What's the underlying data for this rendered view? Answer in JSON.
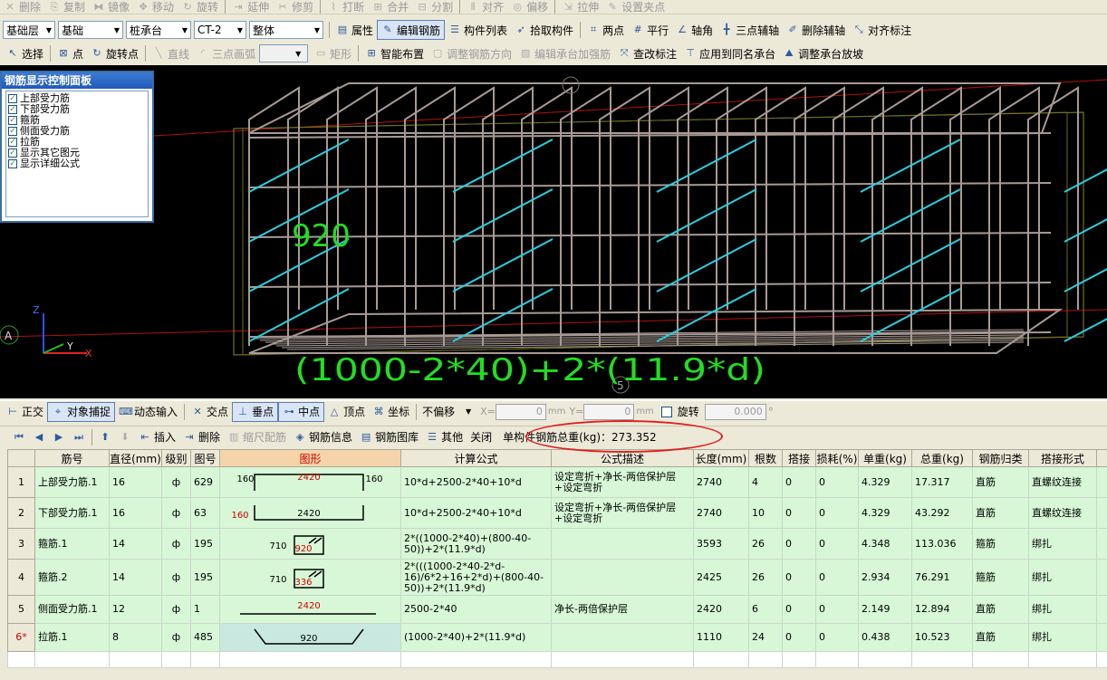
{
  "toolbar1": [
    {
      "label": "删除",
      "icon": "delete-icon",
      "glyph": "✕",
      "disabled": true
    },
    {
      "label": "复制",
      "icon": "copy-icon",
      "glyph": "⎘",
      "disabled": true
    },
    {
      "label": "镜像",
      "icon": "mirror-icon",
      "glyph": "⧓",
      "disabled": true
    },
    {
      "label": "移动",
      "icon": "move-icon",
      "glyph": "✥",
      "disabled": true
    },
    {
      "label": "旋转",
      "icon": "rotate-icon",
      "glyph": "↻",
      "disabled": true
    },
    {
      "label": "延伸",
      "icon": "extend-icon",
      "glyph": "⇥",
      "disabled": true
    },
    {
      "label": "修剪",
      "icon": "trim-icon",
      "glyph": "✂",
      "disabled": true
    },
    {
      "label": "打断",
      "icon": "break-icon",
      "glyph": "⌇",
      "disabled": true
    },
    {
      "label": "合并",
      "icon": "merge-icon",
      "glyph": "⊞",
      "disabled": true
    },
    {
      "label": "分割",
      "icon": "split-icon",
      "glyph": "⊟",
      "disabled": true
    },
    {
      "label": "对齐",
      "icon": "align-icon",
      "glyph": "⫴",
      "disabled": true
    },
    {
      "label": "偏移",
      "icon": "offset-icon",
      "glyph": "◎",
      "disabled": true
    },
    {
      "label": "拉伸",
      "icon": "stretch-icon",
      "glyph": "⇲",
      "disabled": true
    },
    {
      "label": "设置夹点",
      "icon": "grip-icon",
      "glyph": "✎",
      "disabled": true
    }
  ],
  "toolbar2": {
    "combos": [
      {
        "value": "基础层",
        "width": 58
      },
      {
        "value": "基础",
        "width": 72
      },
      {
        "value": "桩承台",
        "width": 72
      },
      {
        "value": "CT-2",
        "width": 58
      },
      {
        "value": "整体",
        "width": 82
      }
    ],
    "buttons": [
      {
        "label": "属性",
        "icon": "properties-icon",
        "glyph": "▤"
      },
      {
        "label": "编辑钢筋",
        "icon": "edit-rebar-icon",
        "glyph": "✎",
        "active": true
      },
      {
        "label": "构件列表",
        "icon": "component-list-icon",
        "glyph": "☰"
      },
      {
        "label": "拾取构件",
        "icon": "pick-component-icon",
        "glyph": "➶"
      },
      {
        "label": "两点",
        "icon": "two-point-icon",
        "glyph": "⌗"
      },
      {
        "label": "平行",
        "icon": "parallel-icon",
        "glyph": "#"
      },
      {
        "label": "轴角",
        "icon": "axis-angle-icon",
        "glyph": "∠"
      },
      {
        "label": "三点辅轴",
        "icon": "three-point-axis-icon",
        "glyph": "╋"
      },
      {
        "label": "删除辅轴",
        "icon": "delete-axis-icon",
        "glyph": "✐"
      },
      {
        "label": "对齐标注",
        "icon": "align-dimension-icon",
        "glyph": "⤡"
      }
    ]
  },
  "toolbar3": [
    {
      "label": "选择",
      "icon": "select-icon",
      "glyph": "↖",
      "disabled": false
    },
    {
      "label": "点",
      "icon": "point-icon",
      "glyph": "⊠",
      "disabled": false
    },
    {
      "label": "旋转点",
      "icon": "rotate-point-icon",
      "glyph": "↻",
      "disabled": false
    },
    {
      "label": "直线",
      "icon": "line-icon",
      "glyph": "╲",
      "disabled": true
    },
    {
      "label": "三点画弧",
      "icon": "arc-icon",
      "glyph": "◜",
      "disabled": true
    },
    {
      "label": "矩形",
      "icon": "rectangle-icon",
      "glyph": "▭",
      "disabled": true
    },
    {
      "label": "智能布置",
      "icon": "smart-layout-icon",
      "glyph": "⊞",
      "disabled": false
    },
    {
      "label": "调整钢筋方向",
      "icon": "adjust-direction-icon",
      "glyph": "▢",
      "disabled": true
    },
    {
      "label": "编辑承台加强筋",
      "icon": "edit-reinforce-icon",
      "glyph": "▨",
      "disabled": true
    },
    {
      "label": "查改标注",
      "icon": "check-dimension-icon",
      "glyph": "⤧",
      "disabled": false
    },
    {
      "label": "应用到同名承台",
      "icon": "apply-same-icon",
      "glyph": "⊤",
      "disabled": false
    },
    {
      "label": "调整承台放坡",
      "icon": "adjust-slope-icon",
      "glyph": "⛰",
      "disabled": false
    }
  ],
  "panel": {
    "title": "钢筋显示控制面板",
    "items": [
      "上部受力筋",
      "下部受力筋",
      "箍筋",
      "侧面受力筋",
      "拉筋",
      "显示其它图元",
      "显示详细公式"
    ]
  },
  "viewport": {
    "dim_text": "920",
    "formula_text": "(1000-2*40)+2*(11.9*d)",
    "marker_a": "A",
    "marker_num": "5",
    "axis_x": "X",
    "axis_y": "Y",
    "axis_z": "Z"
  },
  "statusbar": {
    "toggles": [
      {
        "label": "正交",
        "icon": "ortho-icon",
        "glyph": "⊢",
        "active": false
      },
      {
        "label": "对象捕捉",
        "icon": "snap-icon",
        "glyph": "⌖",
        "active": true
      },
      {
        "label": "动态输入",
        "icon": "dynamic-input-icon",
        "glyph": "⌨",
        "active": false
      },
      {
        "label": "交点",
        "icon": "intersection-icon",
        "glyph": "✕",
        "active": false
      },
      {
        "label": "垂点",
        "icon": "perpendicular-icon",
        "glyph": "⊥",
        "active": true
      },
      {
        "label": "中点",
        "icon": "midpoint-icon",
        "glyph": "⊶",
        "active": true
      },
      {
        "label": "顶点",
        "icon": "vertex-icon",
        "glyph": "△",
        "active": false
      },
      {
        "label": "坐标",
        "icon": "coordinate-icon",
        "glyph": "⌘",
        "active": false
      }
    ],
    "offset_mode": "不偏移",
    "x_label": "X=",
    "x_value": "0",
    "y_label": "Y=",
    "y_value": "0",
    "unit": "mm",
    "rotate_label": "旋转",
    "rotate_value": "0.000",
    "degree": "°"
  },
  "gridbar": {
    "nav": [
      "first-record-icon",
      "prev-record-icon",
      "next-record-icon",
      "last-record-icon"
    ],
    "buttons": [
      {
        "label": "插入",
        "icon": "insert-icon",
        "glyph": "⇤",
        "disabled": false
      },
      {
        "label": "删除",
        "icon": "delete-row-icon",
        "glyph": "⇥",
        "disabled": false
      },
      {
        "label": "缩尺配筋",
        "icon": "scale-rebar-icon",
        "glyph": "▥",
        "disabled": true
      },
      {
        "label": "钢筋信息",
        "icon": "rebar-info-icon",
        "glyph": "◈",
        "disabled": false
      },
      {
        "label": "钢筋图库",
        "icon": "rebar-library-icon",
        "glyph": "▤",
        "disabled": false
      },
      {
        "label": "其他",
        "icon": "other-icon",
        "glyph": "☰",
        "disabled": false
      },
      {
        "label": "关闭",
        "icon": "",
        "glyph": "",
        "disabled": false
      }
    ],
    "total_label": "单构件钢筋总重(kg)：273.352"
  },
  "table": {
    "headers": [
      "筋号",
      "直径(mm)",
      "级别",
      "图号",
      "图形",
      "计算公式",
      "公式描述",
      "长度(mm)",
      "根数",
      "搭接",
      "损耗(%)",
      "单重(kg)",
      "总重(kg)",
      "钢筋归类",
      "搭接形式",
      ""
    ],
    "rows": [
      {
        "rn": "1",
        "name": "上部受力筋.1",
        "dia": "16",
        "grade": "ф",
        "fig": "629",
        "shape": "u-up",
        "s1": "160",
        "s2": "2420",
        "s3": "160",
        "formula": "10*d+2500-2*40+10*d",
        "desc": "设定弯折+净长-两倍保护层+设定弯折",
        "len": "2740",
        "count": "4",
        "lap": "0",
        "loss": "0",
        "unit": "4.329",
        "total": "17.317",
        "cls": "直筋",
        "lapform": "直螺纹连接"
      },
      {
        "rn": "2",
        "name": "下部受力筋.1",
        "dia": "16",
        "grade": "ф",
        "fig": "63",
        "shape": "u-down",
        "s1": "160",
        "s2": "2420",
        "s3": "",
        "formula": "10*d+2500-2*40+10*d",
        "desc": "设定弯折+净长-两倍保护层+设定弯折",
        "len": "2740",
        "count": "10",
        "lap": "0",
        "loss": "0",
        "unit": "4.329",
        "total": "43.292",
        "cls": "直筋",
        "lapform": "直螺纹连接"
      },
      {
        "rn": "3",
        "name": "箍筋.1",
        "dia": "14",
        "grade": "ф",
        "fig": "195",
        "shape": "stirrup",
        "s1": "710",
        "s2": "920",
        "s3": "",
        "formula": "2*((1000-2*40)+(800-40-50))+2*(11.9*d)",
        "desc": "",
        "len": "3593",
        "count": "26",
        "lap": "0",
        "loss": "0",
        "unit": "4.348",
        "total": "113.036",
        "cls": "箍筋",
        "lapform": "绑扎"
      },
      {
        "rn": "4",
        "name": "箍筋.2",
        "dia": "14",
        "grade": "ф",
        "fig": "195",
        "shape": "stirrup",
        "s1": "710",
        "s2": "336",
        "s3": "",
        "formula": "2*(((1000-2*40-2*d-16)/6*2+16+2*d)+(800-40-50))+2*(11.9*d)",
        "desc": "",
        "len": "2425",
        "count": "26",
        "lap": "0",
        "loss": "0",
        "unit": "2.934",
        "total": "76.291",
        "cls": "箍筋",
        "lapform": "绑扎"
      },
      {
        "rn": "5",
        "name": "侧面受力筋.1",
        "dia": "12",
        "grade": "ф",
        "fig": "1",
        "shape": "line",
        "s1": "",
        "s2": "2420",
        "s3": "",
        "formula": "2500-2*40",
        "desc": "净长-两倍保护层",
        "len": "2420",
        "count": "6",
        "lap": "0",
        "loss": "0",
        "unit": "2.149",
        "total": "12.894",
        "cls": "直筋",
        "lapform": "绑扎"
      },
      {
        "rn": "6*",
        "name": "拉筋.1",
        "dia": "8",
        "grade": "ф",
        "fig": "485",
        "shape": "tie",
        "s1": "",
        "s2": "920",
        "s3": "",
        "formula": "(1000-2*40)+2*(11.9*d)",
        "desc": "",
        "len": "1110",
        "count": "24",
        "lap": "0",
        "loss": "0",
        "unit": "0.438",
        "total": "10.523",
        "cls": "直筋",
        "lapform": "绑扎"
      }
    ]
  }
}
